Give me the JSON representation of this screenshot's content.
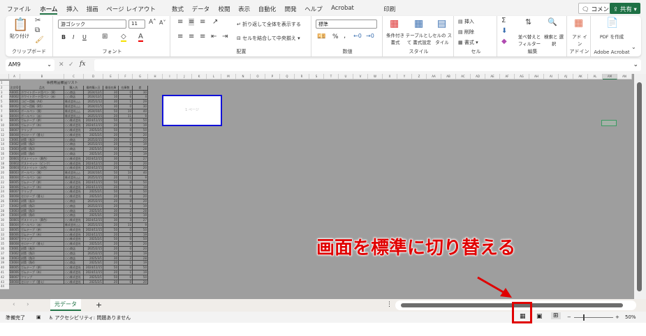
{
  "menu": [
    "ファイル",
    "ホーム",
    "挿入",
    "描画",
    "ページ レイアウト",
    "数式",
    "データ",
    "校閲",
    "表示",
    "自動化",
    "開発",
    "ヘルプ",
    "Acrobat",
    "印刷"
  ],
  "top_buttons": {
    "comment": "コメント",
    "share": "共有"
  },
  "ribbon": {
    "clipboard": {
      "label": "クリップボード",
      "paste": "貼り付け"
    },
    "font": {
      "label": "フォント",
      "name": "游ゴシック",
      "size": "11",
      "bold": "B",
      "italic": "I",
      "underline": "U"
    },
    "alignment": {
      "label": "配置",
      "wrap": "折り返して全体を表示する",
      "merge": "セルを結合して中央揃え"
    },
    "number": {
      "label": "数値",
      "format": "標準",
      "percent": "%"
    },
    "styles": {
      "label": "スタイル",
      "conditional": "条件付き 書式",
      "table": "テーブルとして 書式設定",
      "cell": "セルの スタイル"
    },
    "cells": {
      "label": "セル",
      "insert": "挿入",
      "delete": "削除",
      "format": "書式"
    },
    "editing": {
      "label": "編集",
      "sort": "並べ替えと フィルター",
      "find": "検索と 選択"
    },
    "addins": {
      "label": "アドイン",
      "button": "アド イン"
    },
    "acrobat": {
      "label": "Adobe Acrobat",
      "button": "PDF を作成"
    }
  },
  "formula_bar": {
    "name_box": "AM9",
    "fx": "fx",
    "value": ""
  },
  "columns": [
    "A",
    "B",
    "C",
    "D",
    "E",
    "F",
    "G",
    "H",
    "I",
    "J",
    "K",
    "L",
    "M",
    "N",
    "O",
    "P",
    "Q",
    "R",
    "S",
    "T",
    "U",
    "V",
    "W",
    "X",
    "Y",
    "Z",
    "AA",
    "AB",
    "AC",
    "AD",
    "AE",
    "AF",
    "AG",
    "AH",
    "AI",
    "AJ",
    "AK",
    "AL",
    "AM",
    "AN"
  ],
  "selected_column": "AM",
  "sheet": {
    "title": "事務用品備品リスト",
    "headers": [
      "注文ID",
      "品名",
      "購入先",
      "最終購入日",
      "最低在庫",
      "在庫数",
      "差"
    ],
    "rows": [
      [
        "A0001",
        "ホワイトボード用ペン（黒）",
        "○○商店",
        "2024/12/1",
        "30",
        "0",
        "30"
      ],
      [
        "A0002",
        "ホワイトボード用ペン（赤）",
        "○○商店",
        "2024/12/1",
        "10",
        "6",
        "4"
      ],
      [
        "B0001",
        "コピー用紙（A4）",
        "株式会社△△",
        "2025/1/12",
        "30",
        "1",
        "29"
      ],
      [
        "B0002",
        "コピー用紙（B5）",
        "株式会社△△",
        "2024/11/5",
        "30",
        "0",
        "30"
      ],
      [
        "B0003",
        "ボールペン（黒）",
        "株式会社△△",
        "2024/10/1",
        "50",
        "10",
        "40"
      ],
      [
        "B0004",
        "ボールペン（赤）",
        "株式会社△△",
        "2025/1/15",
        "20",
        "11",
        "9"
      ],
      [
        "B0005",
        "ガムテープ（茶）",
        "○○株式会社",
        "2024/11/15",
        "50",
        "0",
        "50"
      ],
      [
        "B0006",
        "ガムテープ（布）",
        "○○株式会社",
        "2024/11/15",
        "20",
        "1",
        "19"
      ],
      [
        "B0007",
        "クリップ",
        "○○株式会社",
        "2025/2/1",
        "50",
        "0",
        "50"
      ],
      [
        "B0008",
        "セロテープ（替え）",
        "○○株式会社",
        "2025/2/1",
        "20",
        "0",
        "20"
      ],
      [
        "C0001",
        "封筒（長3）",
        "○○商店",
        "2025/2/15",
        "20",
        "0",
        "20"
      ],
      [
        "C0002",
        "封筒（角2）",
        "○○商店",
        "2025/2/15",
        "20",
        "1",
        "19"
      ],
      [
        "C0003",
        "封筒（角3）",
        "○○商店",
        "2025/3/1",
        "30",
        "2",
        "28"
      ],
      [
        "C0004",
        "封筒（角4）",
        "○○商店",
        "2025/3/1",
        "20",
        "1",
        "19"
      ],
      [
        "D0001",
        "ポストイット（黄色）",
        "○○株式会社",
        "2024/12/15",
        "30",
        "3",
        "27"
      ],
      [
        "D0002",
        "ポストイット（ピンク）",
        "○○株式会社",
        "2024/12/15",
        "20",
        "0",
        "20"
      ],
      [
        "D0003",
        "ポストイット（水色）",
        "○○株式会社",
        "2024/12/15",
        "20",
        "0",
        "20"
      ],
      [
        "B0003",
        "ボールペン（黒）",
        "株式会社△△",
        "2024/10/1",
        "50",
        "10",
        "40"
      ],
      [
        "B0004",
        "ボールペン（赤）",
        "株式会社△△",
        "2025/1/15",
        "20",
        "11",
        "9"
      ],
      [
        "B0005",
        "ガムテープ（茶）",
        "○○株式会社",
        "2024/11/15",
        "50",
        "0",
        "50"
      ],
      [
        "B0006",
        "ガムテープ（布）",
        "○○株式会社",
        "2024/11/15",
        "20",
        "1",
        "19"
      ],
      [
        "B0007",
        "クリップ",
        "○○株式会社",
        "2025/2/1",
        "50",
        "0",
        "50"
      ],
      [
        "B0008",
        "セロテープ（替え）",
        "○○株式会社",
        "2025/2/1",
        "20",
        "0",
        "20"
      ],
      [
        "C0001",
        "封筒（長3）",
        "○○商店",
        "2025/2/15",
        "20",
        "0",
        "20"
      ],
      [
        "C0002",
        "封筒（角2）",
        "○○商店",
        "2025/2/15",
        "20",
        "1",
        "19"
      ],
      [
        "C0003",
        "封筒（角3）",
        "○○商店",
        "2025/3/1",
        "30",
        "2",
        "28"
      ],
      [
        "C0004",
        "封筒（角4）",
        "○○商店",
        "2025/3/1",
        "20",
        "1",
        "19"
      ],
      [
        "D0001",
        "ポストイット（黄色）",
        "○○株式会社",
        "2024/12/15",
        "30",
        "3",
        "27"
      ],
      [
        "B0004",
        "ボールペン（赤）",
        "株式会社△△",
        "2025/1/15",
        "20",
        "11",
        "9"
      ],
      [
        "B0005",
        "ガムテープ（茶）",
        "○○株式会社",
        "2024/11/15",
        "50",
        "0",
        "50"
      ],
      [
        "B0006",
        "ガムテープ（布）",
        "○○株式会社",
        "2024/11/15",
        "20",
        "1",
        "19"
      ],
      [
        "B0007",
        "クリップ",
        "○○株式会社",
        "2025/2/1",
        "50",
        "0",
        "50"
      ],
      [
        "B0008",
        "セロテープ（替え）",
        "○○株式会社",
        "2025/2/1",
        "20",
        "0",
        "20"
      ],
      [
        "C0001",
        "封筒（長3）",
        "○○商店",
        "2025/2/15",
        "20",
        "0",
        "20"
      ],
      [
        "C0002",
        "封筒（角2）",
        "○○商店",
        "2025/2/15",
        "20",
        "1",
        "19"
      ],
      [
        "C0003",
        "封筒（角3）",
        "○○商店",
        "2025/3/1",
        "30",
        "2",
        "28"
      ],
      [
        "C0004",
        "封筒（角4）",
        "○○商店",
        "2025/3/1",
        "20",
        "1",
        "19"
      ],
      [
        "B0005",
        "ガムテープ（茶）",
        "○○株式会社",
        "2024/11/15",
        "50",
        "0",
        "50"
      ],
      [
        "B0006",
        "ガムテープ（布）",
        "○○株式会社",
        "2024/11/15",
        "20",
        "1",
        "19"
      ],
      [
        "B0007",
        "クリップ",
        "○○株式会社",
        "2025/2/1",
        "50",
        "0",
        "50"
      ],
      [
        "B0008",
        "セロテープ（替え）",
        "○○株式会社",
        "2025/2/1",
        "20",
        "0",
        "20"
      ]
    ],
    "row_count": 44
  },
  "page_label": "1 ページ",
  "sheet_tabs": [
    "元データ"
  ],
  "status": {
    "ready": "準備完了",
    "accessibility": "アクセシビリティ: 問題ありません",
    "zoom": "50%"
  },
  "zoom_level_percent": 50,
  "annotation": "画面を標準に切り替える"
}
